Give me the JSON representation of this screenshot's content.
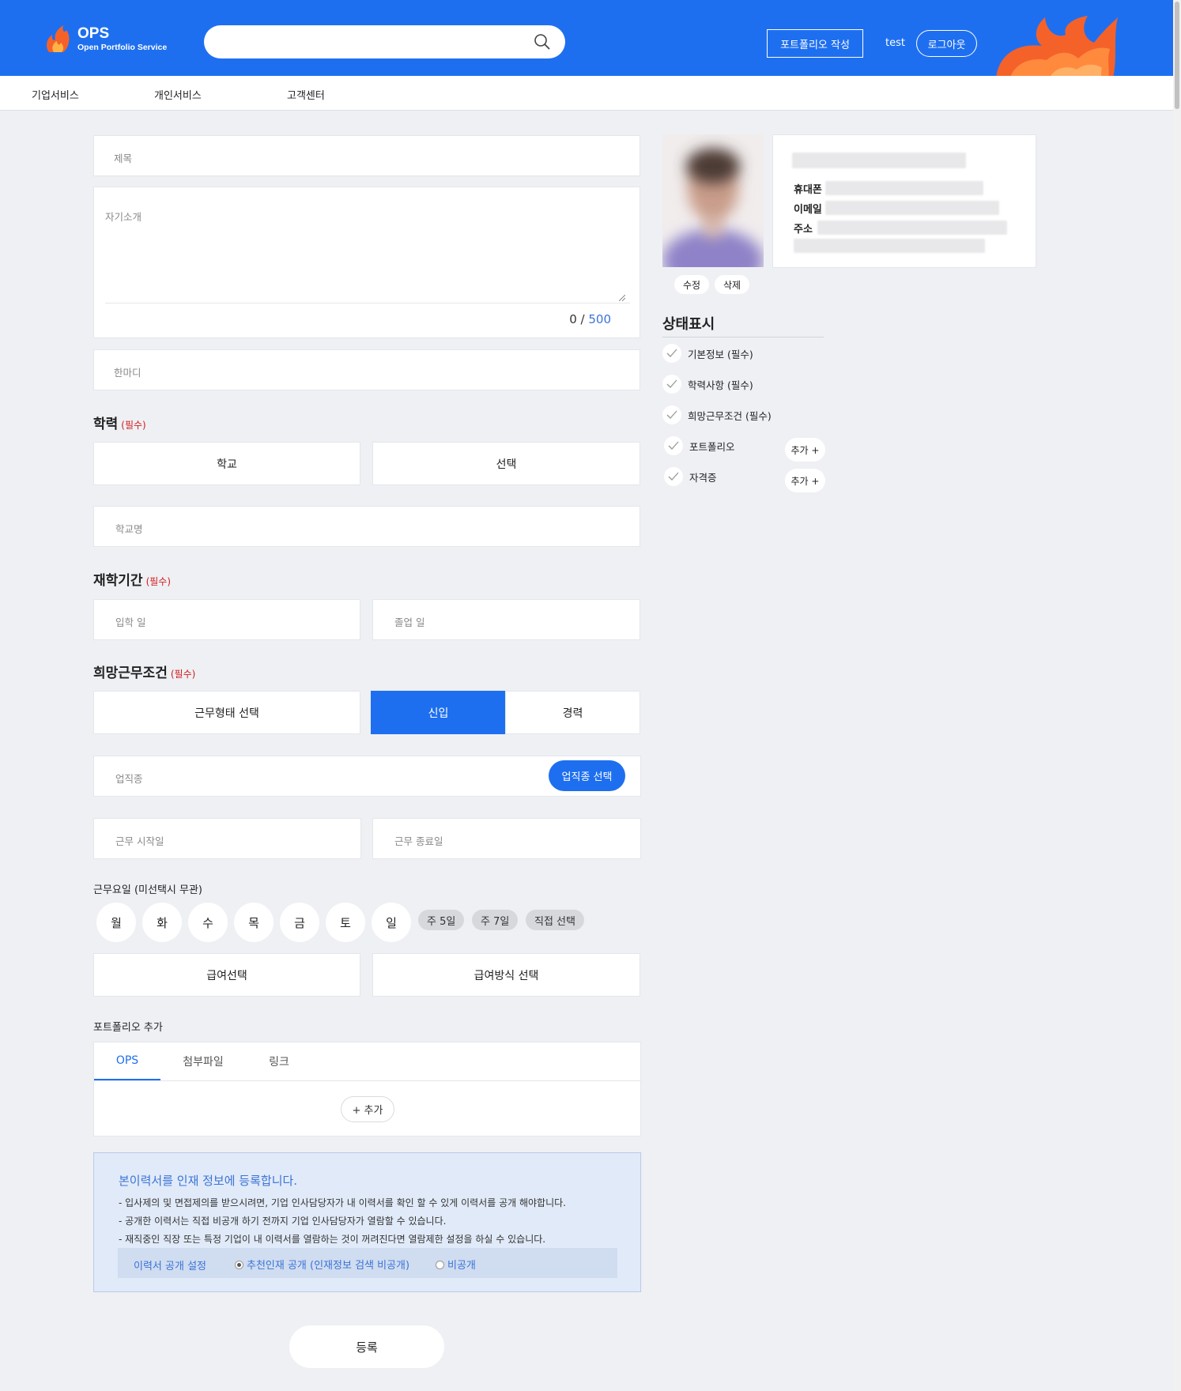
{
  "header": {
    "logo_title": "OPS",
    "logo_subtitle": "Open Portfolio Service",
    "search_placeholder": "",
    "write_button": "포트폴리오 작성",
    "username": "test",
    "logout_button": "로그아웃",
    "brand_color": "#1e6ff0"
  },
  "nav": {
    "items": [
      "기업서비스",
      "개인서비스",
      "고객센터"
    ]
  },
  "form": {
    "title_placeholder": "제목",
    "intro_placeholder": "자기소개",
    "char_count": "0",
    "char_separator": " / ",
    "char_max": "500",
    "oneliner_placeholder": "한마디",
    "education": {
      "title": "학력",
      "required": "(필수)",
      "school_type": "학교",
      "select": "선택",
      "school_name_placeholder": "학교명"
    },
    "period": {
      "title": "재학기간",
      "required": "(필수)",
      "entry_placeholder": "입학 일",
      "graduation_placeholder": "졸업 일"
    },
    "work": {
      "title": "희망근무조건",
      "required": "(필수)",
      "work_type": "근무형태 선택",
      "career_options": [
        "신입",
        "경력"
      ],
      "selected_career": "신입",
      "job_placeholder": "업직종",
      "job_select_button": "업직종 선택",
      "start_placeholder": "근무 시작일",
      "end_placeholder": "근무 종료일",
      "days_label": "근무요일 (미선택시 무관)",
      "days": [
        "월",
        "화",
        "수",
        "목",
        "금",
        "토",
        "일"
      ],
      "day_presets": [
        "주 5일",
        "주 7일",
        "직접 선택"
      ],
      "salary_select": "급여선택",
      "salary_method_select": "급여방식 선택"
    },
    "portfolio": {
      "title": "포트폴리오 추가",
      "tabs": [
        "OPS",
        "첨부파일",
        "링크"
      ],
      "active_tab": "OPS",
      "add_button": "+ 추가"
    },
    "notice": {
      "title": "본이력서를 인재 정보에 등록합니다.",
      "lines": [
        "- 입사제의 및 면접제의를 받으시려면, 기업 인사담당자가 내 이력서를 확인 할 수 있게 이력서를 공개 해야합니다.",
        "- 공개한 이력서는 직접 비공개 하기 전까지 기업 인사담당자가 열람할 수 있습니다.",
        "- 재직중인 직장 또는 특정 기업이 내 이력서를 열람하는 것이 꺼려진다면 열람제한 설정을 하실 수 있습니다."
      ],
      "setting_label": "이력서 공개 설정",
      "option_public": "추천인재 공개 (인재정보 검색 비공개)",
      "option_private": "비공개",
      "selected": "추천인재 공개 (인재정보 검색 비공개)"
    },
    "submit_button": "등록"
  },
  "profile": {
    "phone_label": "휴대폰",
    "email_label": "이메일",
    "address_label": "주소",
    "edit_button": "수정",
    "delete_button": "삭제"
  },
  "status": {
    "title": "상태표시",
    "items": [
      {
        "label": "기본정보 (필수)",
        "add": ""
      },
      {
        "label": "학력사항 (필수)",
        "add": ""
      },
      {
        "label": "희망근무조건 (필수)",
        "add": ""
      },
      {
        "label": "포트폴리오",
        "add": "추가 +"
      },
      {
        "label": "자격증",
        "add": "추가 +"
      }
    ]
  }
}
